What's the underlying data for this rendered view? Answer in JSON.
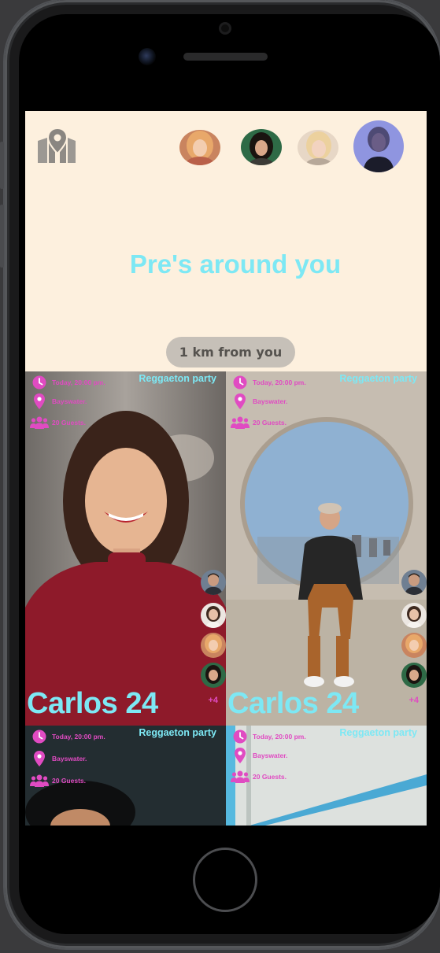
{
  "header": {
    "headline": "Pre's around you",
    "distance": "1 km from you",
    "map_icon": "map-pin-icon",
    "avatars": [
      "avatar-1",
      "avatar-2",
      "avatar-3",
      "avatar-selected"
    ]
  },
  "cards": [
    {
      "title": "Reggaeton party",
      "time": "Today, 20:00 pm.",
      "place": "Bayswater.",
      "guests": "20 Guests.",
      "name": "Carlos 24",
      "more_guests": "+4"
    },
    {
      "title": "Reggaeton party",
      "time": "Today, 20:00 pm.",
      "place": "Bayswater.",
      "guests": "20 Guests.",
      "name": "Carlos 24",
      "more_guests": "+4"
    },
    {
      "title": "Reggaeton party",
      "time": "Today, 20:00 pm.",
      "place": "Bayswater.",
      "guests": "20 Guests."
    },
    {
      "title": "Reggaeton party",
      "time": "Today, 20:00 pm.",
      "place": "Bayswater.",
      "guests": "20 Guests."
    }
  ],
  "colors": {
    "background": "#fdf0de",
    "accent_cyan": "#7de8f4",
    "accent_pink": "#e04bc2",
    "pill": "#c6c0b8"
  }
}
